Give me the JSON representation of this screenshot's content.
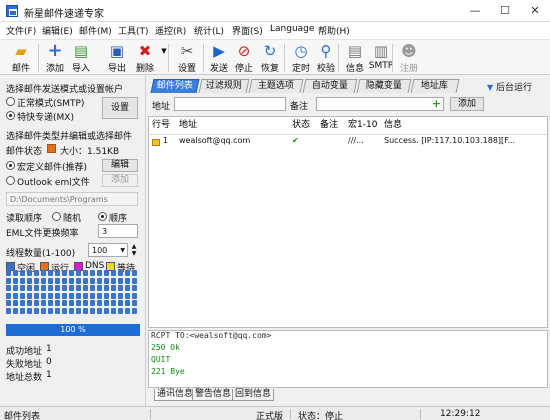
{
  "window": {
    "title": "新星邮件速递专家"
  },
  "menu": [
    "文件(F)",
    "编辑(E)",
    "邮件(M)",
    "工具(T)",
    "遥控(R)",
    "统计(L)",
    "界面(S)",
    "Language",
    "帮助(H)"
  ],
  "toolbar": [
    {
      "label": "邮件",
      "icon": "folder-mail-icon"
    },
    {
      "label": "添加",
      "icon": "add-icon"
    },
    {
      "label": "导入",
      "icon": "import-icon"
    },
    {
      "label": "导出",
      "icon": "save-export-icon"
    },
    {
      "label": "删除",
      "icon": "delete-icon"
    },
    {
      "label": "设置",
      "icon": "settings-tools-icon"
    },
    {
      "label": "发送",
      "icon": "play-icon"
    },
    {
      "label": "停止",
      "icon": "stop-icon"
    },
    {
      "label": "恢复",
      "icon": "refresh-icon"
    },
    {
      "label": "定时",
      "icon": "clock-icon"
    },
    {
      "label": "校验",
      "icon": "verify-icon"
    },
    {
      "label": "信息",
      "icon": "info-icon"
    },
    {
      "label": "SMTP",
      "icon": "smtp-icon"
    },
    {
      "label": "注册",
      "icon": "register-icon"
    }
  ],
  "left": {
    "mode_label": "选择邮件发送模式或设置帐户",
    "mode_normal": "正常模式(SMTP)",
    "mode_fast": "特快专递(MX)",
    "settings_button": "设置",
    "type_label": "选择邮件类型并编辑或选择邮件",
    "status_label": "邮件状态",
    "size_label": "大小：1.51KB",
    "macro_label": "宏定义邮件(推荐)",
    "edit_button": "编辑",
    "outlook_label": "Outlook eml文件",
    "add_button": "添加",
    "path_value": "D:\\Documents\\Programs",
    "read_order_label": "读取顺序",
    "random_label": "随机",
    "sequence_label": "顺序",
    "eml_freq_label": "EML文件更换频率",
    "eml_freq_value": "3",
    "threads_label": "线程数量(1-100)",
    "threads_value": "100",
    "legend_idle": "空闲",
    "legend_running": "运行",
    "legend_dns": "DNS",
    "legend_wait": "等待",
    "progress_text": "100 %",
    "progress_fraction": 1.0,
    "success_label": "成功地址",
    "success_value": "1",
    "fail_label": "失败地址",
    "fail_value": "0",
    "total_label": "地址总数",
    "total_value": "1"
  },
  "tabs": [
    "邮件列表",
    "过滤规则",
    "主题选项",
    "自动变量",
    "隐藏变量",
    "地址库"
  ],
  "bg_run": "后台运行",
  "filter": {
    "address_label": "地址",
    "note_label": "备注",
    "add_button": "添加"
  },
  "list": {
    "headers": [
      "行号",
      "地址",
      "状态",
      "备注",
      "宏1-10",
      "信息"
    ],
    "rows": [
      {
        "num": "1",
        "address": "wealsoft@qq.com",
        "status": "✔",
        "note": "",
        "macro": "///...",
        "info": "Success. [IP:117.10.103.188][F..."
      }
    ]
  },
  "log": {
    "lines": [
      "RCPT TO:<wealsoft@qq.com>",
      "250 Ok",
      "QUIT",
      "221 Bye"
    ],
    "tabs": [
      "通讯信息",
      "警告信息",
      "回到信息"
    ]
  },
  "status": {
    "left": "邮件列表",
    "edition": "正式版",
    "state": "状态：停止",
    "time": "12:29:12"
  },
  "colors": {
    "tab_active": "#3b7fd6",
    "progress": "#1e6cd6",
    "legend_idle": "#3a74c9",
    "legend_running": "#e07020",
    "legend_dns": "#d020d0",
    "legend_wait": "#f0e000"
  }
}
